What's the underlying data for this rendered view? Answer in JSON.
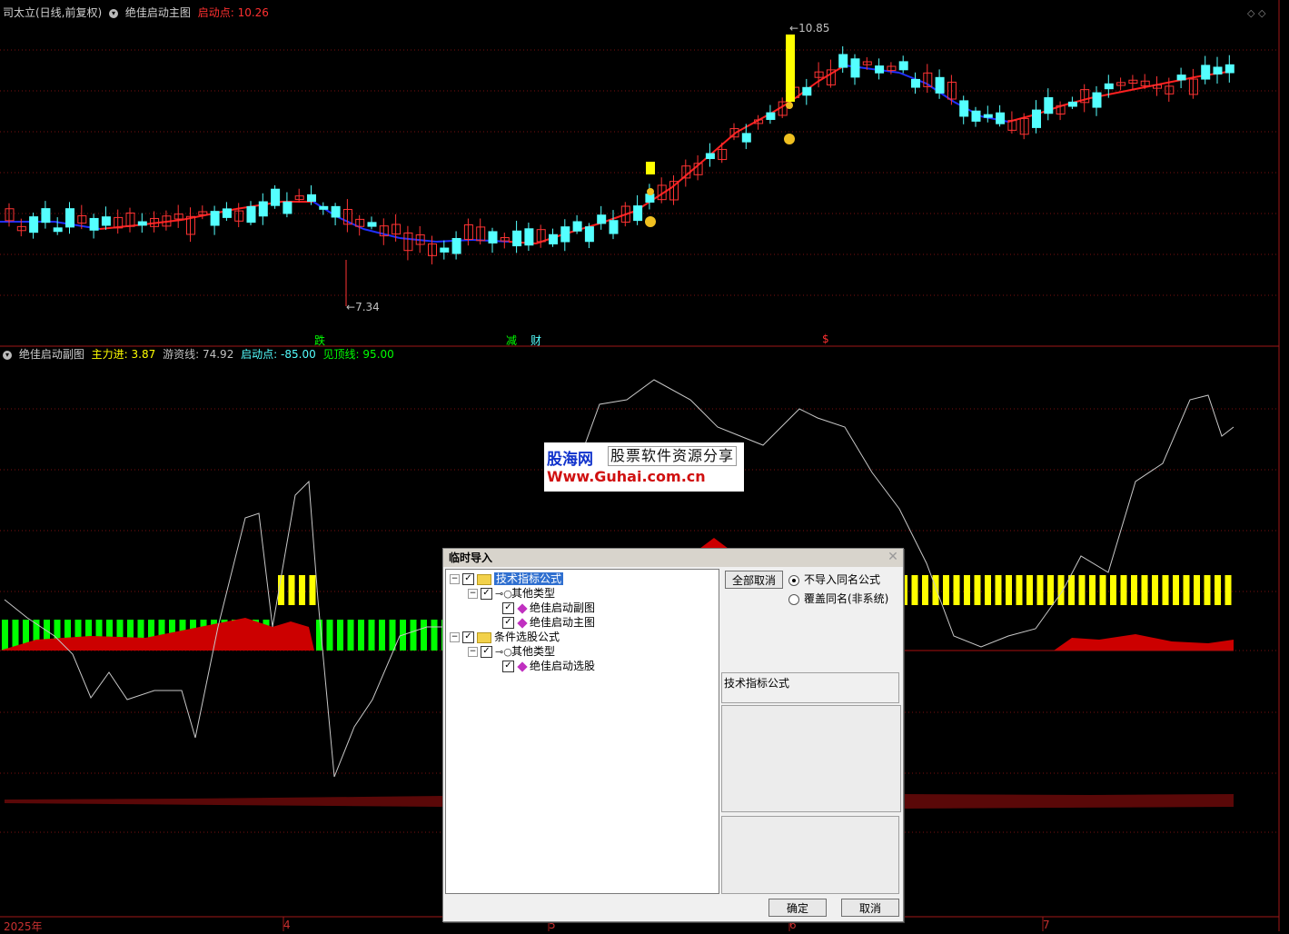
{
  "main_chart": {
    "stock_name": "司太立(日线,前复权)",
    "indicator_name": "绝佳启动主图",
    "launch_label": "启动点:",
    "launch_value": "10.26",
    "high_label": "10.85",
    "low_label": "7.34",
    "markers": [
      "跌",
      "减",
      "财",
      "$"
    ]
  },
  "sub_chart": {
    "indicator_name": "绝佳启动副图",
    "main_in_label": "主力进:",
    "main_in_value": "3.87",
    "retail_label": "游资线:",
    "retail_value": "74.92",
    "launch_label": "启动点:",
    "launch_value": "-85.00",
    "top_label": "见顶线:",
    "top_value": "95.00"
  },
  "x_axis": {
    "labels": [
      "2025年",
      "4",
      "5",
      "6",
      "7"
    ]
  },
  "watermark": {
    "brand": "股海网",
    "slogan": "股票软件资源分享",
    "url": "Www.Guhai.com.cn"
  },
  "dialog": {
    "title": "临时导入",
    "tree": [
      {
        "label": "技术指标公式",
        "checked": true,
        "selected": true
      },
      {
        "label": "其他类型",
        "checked": true
      },
      {
        "label": "绝佳启动副图",
        "checked": true
      },
      {
        "label": "绝佳启动主图",
        "checked": true
      },
      {
        "label": "条件选股公式",
        "checked": true
      },
      {
        "label": "其他类型",
        "checked": true
      },
      {
        "label": "绝佳启动选股",
        "checked": true
      }
    ],
    "deselect_all_label": "全部取消",
    "radio_no_import": "不导入同名公式",
    "radio_overwrite": "覆盖同名(非系统)",
    "description": "技术指标公式",
    "ok_label": "确定",
    "cancel_label": "取消"
  },
  "colors": {
    "up": "#ff3333",
    "down": "#54ffff",
    "ma_up": "#ff2020",
    "ma_down": "#2030ff",
    "bar_green": "#00ff00",
    "bar_yellow": "#ffff00",
    "grid": "#7a1010"
  }
}
